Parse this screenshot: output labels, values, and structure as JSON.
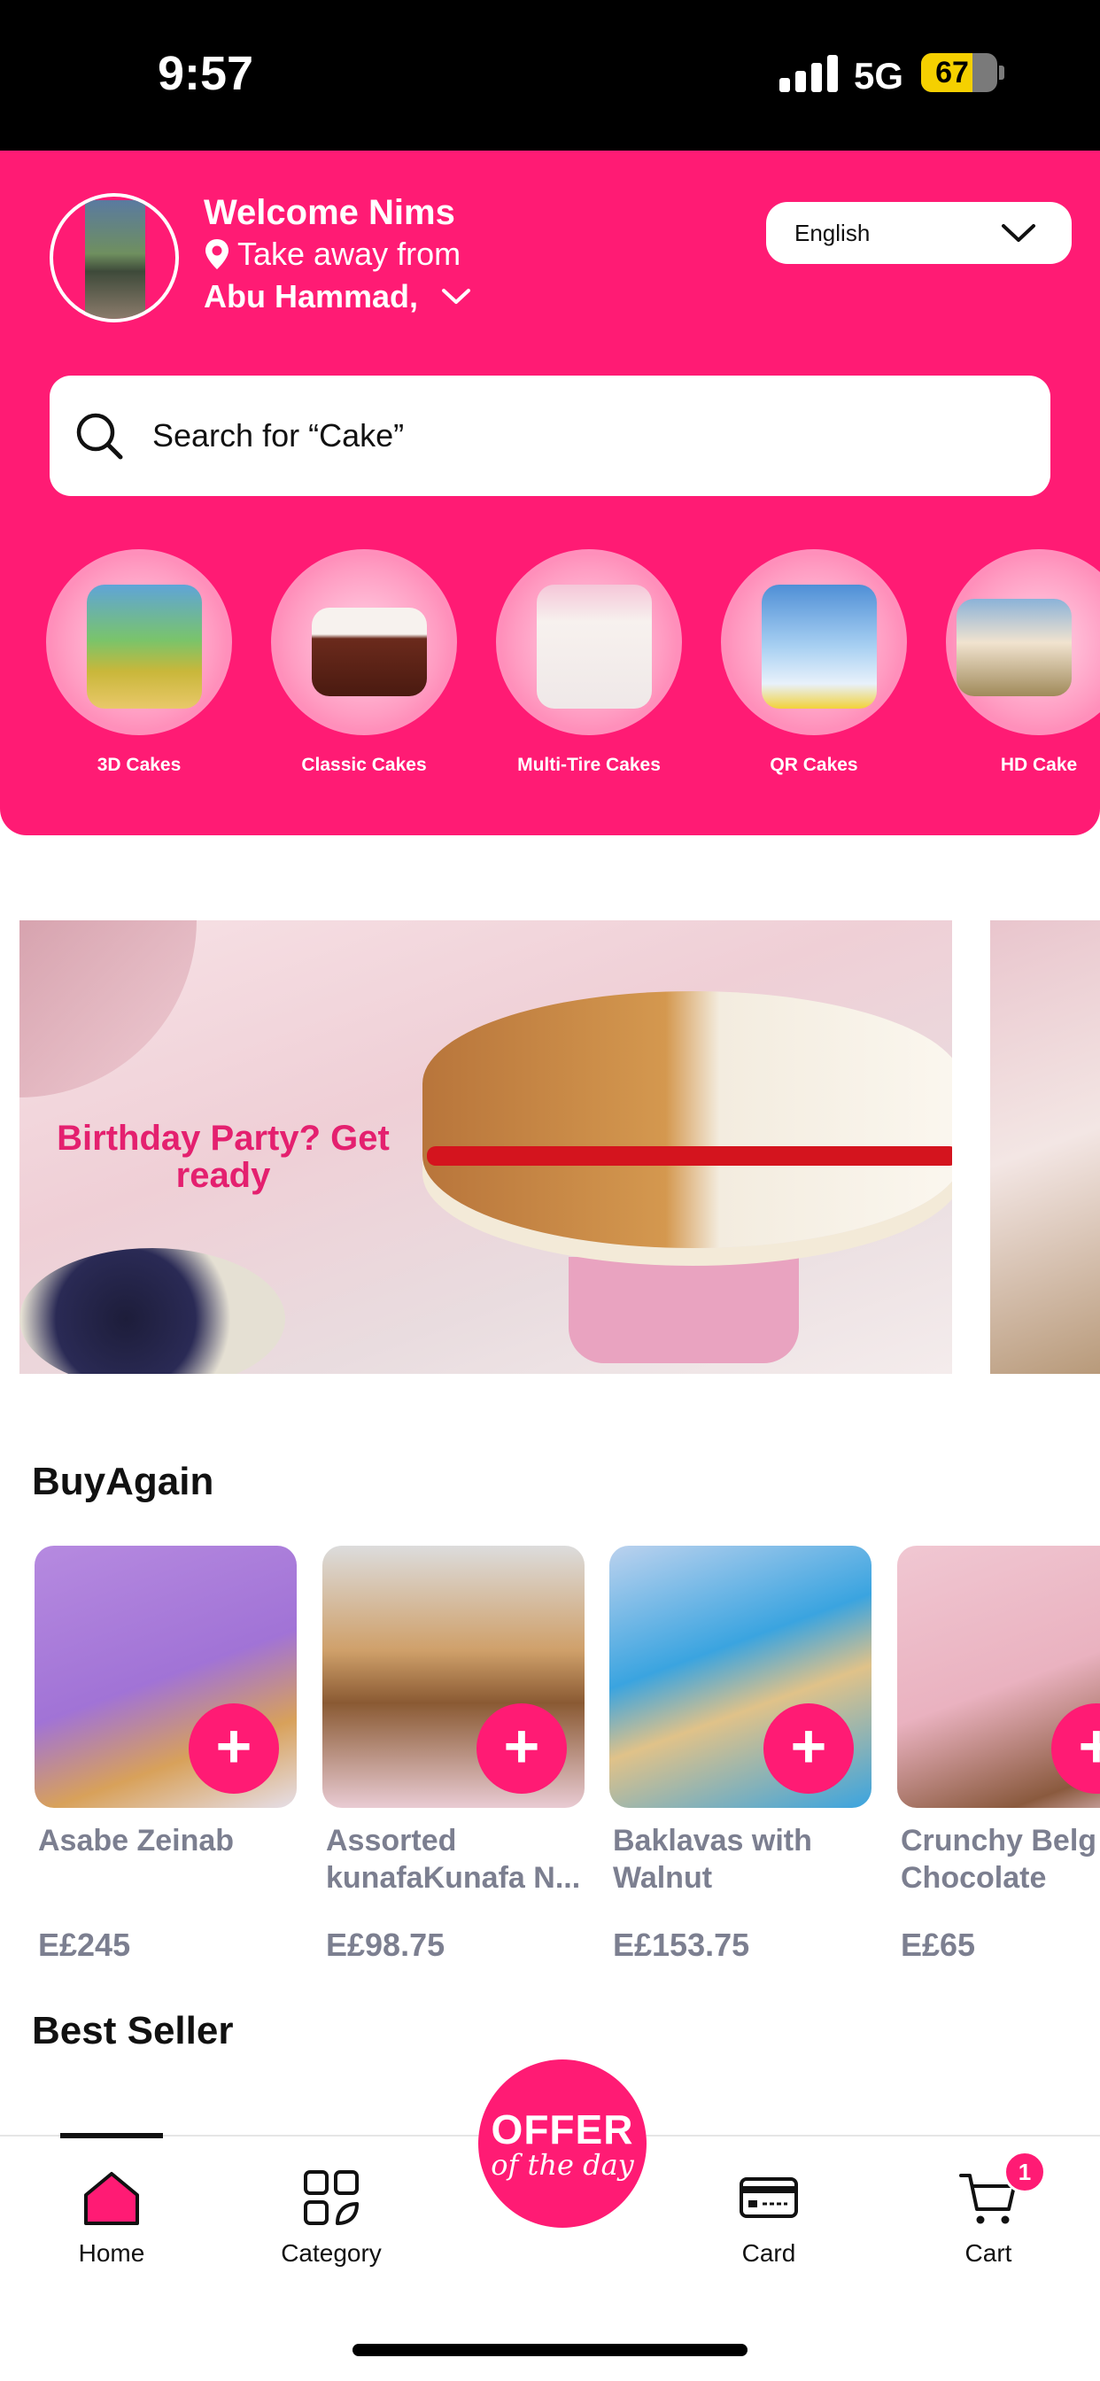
{
  "status_bar": {
    "time": "9:57",
    "network": "5G",
    "battery": "67",
    "battery_level": 0.67
  },
  "header": {
    "welcome": "Welcome Nims",
    "takeaway": "Take away from",
    "location": "Abu Hammad,",
    "language": "English",
    "search_placeholder": "Search for “Cake”"
  },
  "categories": [
    {
      "label": "3D Cakes"
    },
    {
      "label": "Classic Cakes"
    },
    {
      "label": "Multi-Tire Cakes"
    },
    {
      "label": "QR Cakes"
    },
    {
      "label": "HD Cake"
    }
  ],
  "banner": {
    "text": "Birthday Party? Get ready"
  },
  "buy_again": {
    "title": "BuyAgain",
    "products": [
      {
        "name": "Asabe Zeinab",
        "name2": "",
        "price": "E£245"
      },
      {
        "name": "Assorted",
        "name2": "kunafaKunafa N...",
        "price": "E£98.75"
      },
      {
        "name": "Baklavas with",
        "name2": "Walnut",
        "price": "E£153.75"
      },
      {
        "name": "Crunchy Belg",
        "name2": "Chocolate",
        "price": "E£65"
      }
    ]
  },
  "best_seller": {
    "title": "Best Seller"
  },
  "nav": {
    "home": "Home",
    "category": "Category",
    "offer_main": "OFFER",
    "offer_sub": "of the day",
    "card": "Card",
    "cart": "Cart",
    "cart_count": "1"
  },
  "colors": {
    "brand": "#ff1b74",
    "muted_text": "#7c7f90"
  }
}
